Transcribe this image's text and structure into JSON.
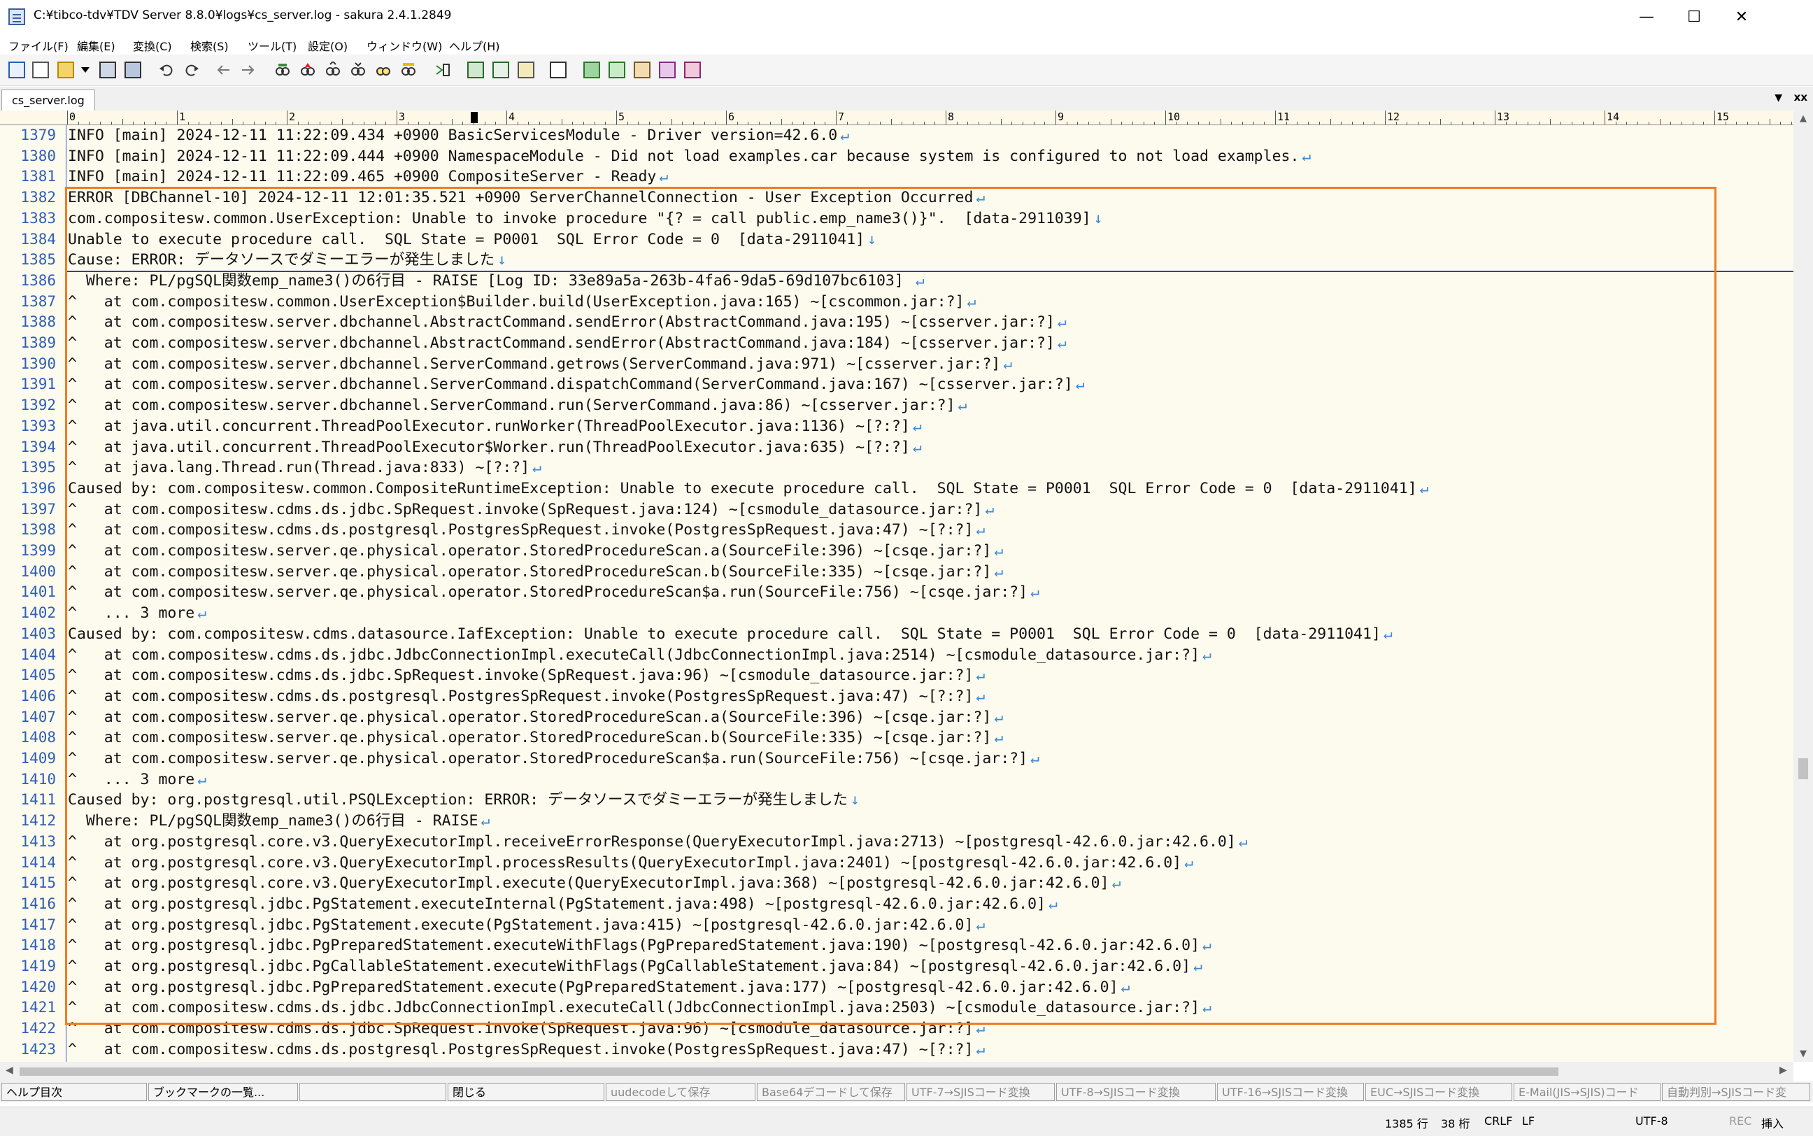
{
  "window": {
    "title": "C:¥tibco-tdv¥TDV Server 8.8.0¥logs¥cs_server.log - sakura 2.4.1.2849",
    "minimize": "—",
    "maximize": "☐",
    "close": "✕"
  },
  "menu": [
    "ファイル(F)",
    "編集(E)",
    "変換(C)",
    "検索(S)",
    "ツール(T)",
    "設定(O)",
    "ウィンドウ(W)",
    "ヘルプ(H)"
  ],
  "tab": {
    "label": "cs_server.log",
    "dropdown": "▼",
    "close": "xx"
  },
  "ruler": {
    "marks": [
      "0",
      "1",
      "2",
      "3",
      "4",
      "5",
      "6",
      "7",
      "8",
      "9",
      "10",
      "11",
      "12",
      "13",
      "14",
      "15"
    ]
  },
  "lines": [
    {
      "num": "1379",
      "text": "INFO [main] 2024-12-11 11:22:09.434 +0900 BasicServicesModule - Driver version=42.6.0",
      "eol": "↵"
    },
    {
      "num": "1380",
      "text": "INFO [main] 2024-12-11 11:22:09.444 +0900 NamespaceModule - Did not load examples.car because system is configured to not load examples.",
      "eol": "↵"
    },
    {
      "num": "1381",
      "text": "INFO [main] 2024-12-11 11:22:09.465 +0900 CompositeServer - Ready",
      "eol": "↵"
    },
    {
      "num": "1382",
      "text": "ERROR [DBChannel-10] 2024-12-11 12:01:35.521 +0900 ServerChannelConnection - User Exception Occurred",
      "eol": "↵"
    },
    {
      "num": "1383",
      "text": "com.compositesw.common.UserException: Unable to invoke procedure \"{? = call public.emp_name3()}\".  [data-2911039]",
      "eol": "↓"
    },
    {
      "num": "1384",
      "text": "Unable to execute procedure call.  SQL State = P0001  SQL Error Code = 0  [data-2911041]",
      "eol": "↓"
    },
    {
      "num": "1385",
      "text": "Cause: ERROR: データソースでダミーエラーが発生しました",
      "eol": "↓"
    },
    {
      "num": "1386",
      "text": "  Where: PL/pgSQL関数emp_name3()の6行目 - RAISE [Log ID: 33e89a5a-263b-4fa6-9da5-69d107bc6103] ",
      "eol": "↵"
    },
    {
      "num": "1387",
      "text": "^   at com.compositesw.common.UserException$Builder.build(UserException.java:165) ~[cscommon.jar:?]",
      "eol": "↵"
    },
    {
      "num": "1388",
      "text": "^   at com.compositesw.server.dbchannel.AbstractCommand.sendError(AbstractCommand.java:195) ~[csserver.jar:?]",
      "eol": "↵"
    },
    {
      "num": "1389",
      "text": "^   at com.compositesw.server.dbchannel.AbstractCommand.sendError(AbstractCommand.java:184) ~[csserver.jar:?]",
      "eol": "↵"
    },
    {
      "num": "1390",
      "text": "^   at com.compositesw.server.dbchannel.ServerCommand.getrows(ServerCommand.java:971) ~[csserver.jar:?]",
      "eol": "↵"
    },
    {
      "num": "1391",
      "text": "^   at com.compositesw.server.dbchannel.ServerCommand.dispatchCommand(ServerCommand.java:167) ~[csserver.jar:?]",
      "eol": "↵"
    },
    {
      "num": "1392",
      "text": "^   at com.compositesw.server.dbchannel.ServerCommand.run(ServerCommand.java:86) ~[csserver.jar:?]",
      "eol": "↵"
    },
    {
      "num": "1393",
      "text": "^   at java.util.concurrent.ThreadPoolExecutor.runWorker(ThreadPoolExecutor.java:1136) ~[?:?]",
      "eol": "↵"
    },
    {
      "num": "1394",
      "text": "^   at java.util.concurrent.ThreadPoolExecutor$Worker.run(ThreadPoolExecutor.java:635) ~[?:?]",
      "eol": "↵"
    },
    {
      "num": "1395",
      "text": "^   at java.lang.Thread.run(Thread.java:833) ~[?:?]",
      "eol": "↵"
    },
    {
      "num": "1396",
      "text": "Caused by: com.compositesw.common.CompositeRuntimeException: Unable to execute procedure call.  SQL State = P0001  SQL Error Code = 0  [data-2911041]",
      "eol": "↵"
    },
    {
      "num": "1397",
      "text": "^   at com.compositesw.cdms.ds.jdbc.SpRequest.invoke(SpRequest.java:124) ~[csmodule_datasource.jar:?]",
      "eol": "↵"
    },
    {
      "num": "1398",
      "text": "^   at com.compositesw.cdms.ds.postgresql.PostgresSpRequest.invoke(PostgresSpRequest.java:47) ~[?:?]",
      "eol": "↵"
    },
    {
      "num": "1399",
      "text": "^   at com.compositesw.server.qe.physical.operator.StoredProcedureScan.a(SourceFile:396) ~[csqe.jar:?]",
      "eol": "↵"
    },
    {
      "num": "1400",
      "text": "^   at com.compositesw.server.qe.physical.operator.StoredProcedureScan.b(SourceFile:335) ~[csqe.jar:?]",
      "eol": "↵"
    },
    {
      "num": "1401",
      "text": "^   at com.compositesw.server.qe.physical.operator.StoredProcedureScan$a.run(SourceFile:756) ~[csqe.jar:?]",
      "eol": "↵"
    },
    {
      "num": "1402",
      "text": "^   ... 3 more",
      "eol": "↵"
    },
    {
      "num": "1403",
      "text": "Caused by: com.compositesw.cdms.datasource.IafException: Unable to execute procedure call.  SQL State = P0001  SQL Error Code = 0  [data-2911041]",
      "eol": "↵"
    },
    {
      "num": "1404",
      "text": "^   at com.compositesw.cdms.ds.jdbc.JdbcConnectionImpl.executeCall(JdbcConnectionImpl.java:2514) ~[csmodule_datasource.jar:?]",
      "eol": "↵"
    },
    {
      "num": "1405",
      "text": "^   at com.compositesw.cdms.ds.jdbc.SpRequest.invoke(SpRequest.java:96) ~[csmodule_datasource.jar:?]",
      "eol": "↵"
    },
    {
      "num": "1406",
      "text": "^   at com.compositesw.cdms.ds.postgresql.PostgresSpRequest.invoke(PostgresSpRequest.java:47) ~[?:?]",
      "eol": "↵"
    },
    {
      "num": "1407",
      "text": "^   at com.compositesw.server.qe.physical.operator.StoredProcedureScan.a(SourceFile:396) ~[csqe.jar:?]",
      "eol": "↵"
    },
    {
      "num": "1408",
      "text": "^   at com.compositesw.server.qe.physical.operator.StoredProcedureScan.b(SourceFile:335) ~[csqe.jar:?]",
      "eol": "↵"
    },
    {
      "num": "1409",
      "text": "^   at com.compositesw.server.qe.physical.operator.StoredProcedureScan$a.run(SourceFile:756) ~[csqe.jar:?]",
      "eol": "↵"
    },
    {
      "num": "1410",
      "text": "^   ... 3 more",
      "eol": "↵"
    },
    {
      "num": "1411",
      "text": "Caused by: org.postgresql.util.PSQLException: ERROR: データソースでダミーエラーが発生しました",
      "eol": "↓"
    },
    {
      "num": "1412",
      "text": "  Where: PL/pgSQL関数emp_name3()の6行目 - RAISE",
      "eol": "↵"
    },
    {
      "num": "1413",
      "text": "^   at org.postgresql.core.v3.QueryExecutorImpl.receiveErrorResponse(QueryExecutorImpl.java:2713) ~[postgresql-42.6.0.jar:42.6.0]",
      "eol": "↵"
    },
    {
      "num": "1414",
      "text": "^   at org.postgresql.core.v3.QueryExecutorImpl.processResults(QueryExecutorImpl.java:2401) ~[postgresql-42.6.0.jar:42.6.0]",
      "eol": "↵"
    },
    {
      "num": "1415",
      "text": "^   at org.postgresql.core.v3.QueryExecutorImpl.execute(QueryExecutorImpl.java:368) ~[postgresql-42.6.0.jar:42.6.0]",
      "eol": "↵"
    },
    {
      "num": "1416",
      "text": "^   at org.postgresql.jdbc.PgStatement.executeInternal(PgStatement.java:498) ~[postgresql-42.6.0.jar:42.6.0]",
      "eol": "↵"
    },
    {
      "num": "1417",
      "text": "^   at org.postgresql.jdbc.PgStatement.execute(PgStatement.java:415) ~[postgresql-42.6.0.jar:42.6.0]",
      "eol": "↵"
    },
    {
      "num": "1418",
      "text": "^   at org.postgresql.jdbc.PgPreparedStatement.executeWithFlags(PgPreparedStatement.java:190) ~[postgresql-42.6.0.jar:42.6.0]",
      "eol": "↵"
    },
    {
      "num": "1419",
      "text": "^   at org.postgresql.jdbc.PgCallableStatement.executeWithFlags(PgCallableStatement.java:84) ~[postgresql-42.6.0.jar:42.6.0]",
      "eol": "↵"
    },
    {
      "num": "1420",
      "text": "^   at org.postgresql.jdbc.PgPreparedStatement.execute(PgPreparedStatement.java:177) ~[postgresql-42.6.0.jar:42.6.0]",
      "eol": "↵"
    },
    {
      "num": "1421",
      "text": "^   at com.compositesw.cdms.ds.jdbc.JdbcConnectionImpl.executeCall(JdbcConnectionImpl.java:2503) ~[csmodule_datasource.jar:?]",
      "eol": "↵"
    },
    {
      "num": "1422",
      "text": "^   at com.compositesw.cdms.ds.jdbc.SpRequest.invoke(SpRequest.java:96) ~[csmodule_datasource.jar:?]",
      "eol": "↵"
    },
    {
      "num": "1423",
      "text": "^   at com.compositesw.cdms.ds.postgresql.PostgresSpRequest.invoke(PostgresSpRequest.java:47) ~[?:?]",
      "eol": "↵"
    }
  ],
  "function_keys": [
    {
      "label": "ヘルプ目次",
      "enabled": true
    },
    {
      "label": "ブックマークの一覧...",
      "enabled": true
    },
    {
      "label": "",
      "enabled": true
    },
    {
      "label": "閉じる",
      "enabled": true
    },
    {
      "label": "uudecodeして保存",
      "enabled": false
    },
    {
      "label": "Base64デコードして保存",
      "enabled": false
    },
    {
      "label": "UTF-7→SJISコード変換",
      "enabled": false
    },
    {
      "label": "UTF-8→SJISコード変換",
      "enabled": false
    },
    {
      "label": "UTF-16→SJISコード変換",
      "enabled": false
    },
    {
      "label": "EUC→SJISコード変換",
      "enabled": false
    },
    {
      "label": "E-Mail(JIS→SJIS)コード",
      "enabled": false
    },
    {
      "label": "自動判別→SJISコード変",
      "enabled": false
    }
  ],
  "status": {
    "line": "1385 行",
    "col": "38 桁",
    "line_ending": "CRLF",
    "caret_line_ending": "LF",
    "encoding": "UTF-8",
    "rec": "REC",
    "mode": "挿入"
  },
  "colors": {
    "highlight_border": "#f07d22",
    "line_number": "#2f5fb3",
    "eol_mark": "#3b8ad6",
    "editor_bg": "#fdfaee"
  }
}
